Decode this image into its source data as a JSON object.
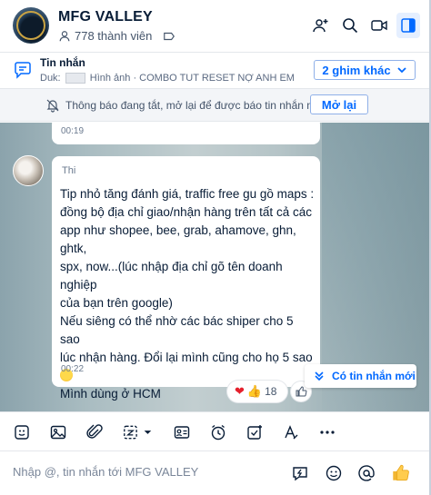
{
  "header": {
    "title": "MFG VALLEY",
    "members": "778 thành viên",
    "icons": [
      "add-member-icon",
      "search-icon",
      "video-call-icon",
      "sidebar-toggle-icon"
    ]
  },
  "pinned": {
    "title": "Tin nhắn",
    "sender": "Duk:",
    "preview": "Hình ảnh · COMBO TUT RESET NỢ ANH EM THA...",
    "button_label": "2 ghim khác"
  },
  "notice": {
    "text": "Thông báo đang tắt, mở lại để được báo tin nhắn mới",
    "button_label": "Mở lại"
  },
  "chat": {
    "previous_time": "00:19",
    "message": {
      "sender": "Thi",
      "lines": [
        "Tip nhỏ tăng đánh giá, traffic free gu gồ maps :",
        "đồng bộ địa chỉ giao/nhận hàng trên tất cả các",
        "app như shopee, bee, grab, ahamove, ghn, ghtk,",
        "spx, now...(lúc nhập địa chỉ gõ tên doanh nghiệp",
        "của bạn trên google)",
        "Nếu siêng có thể nhờ các bác shiper cho 5 sao",
        "lúc nhận hàng. Đổi lại mình cũng cho họ 5 sao"
      ],
      "last_line": "Mình dùng ở HCM",
      "time": "00:22",
      "reaction_count": "18"
    },
    "new_messages_label": "Có tin nhắn mới"
  },
  "composer": {
    "placeholder": "Nhập @, tin nhắn tới MFG VALLEY"
  },
  "colors": {
    "accent": "#0068ff",
    "text": "#081c36"
  }
}
